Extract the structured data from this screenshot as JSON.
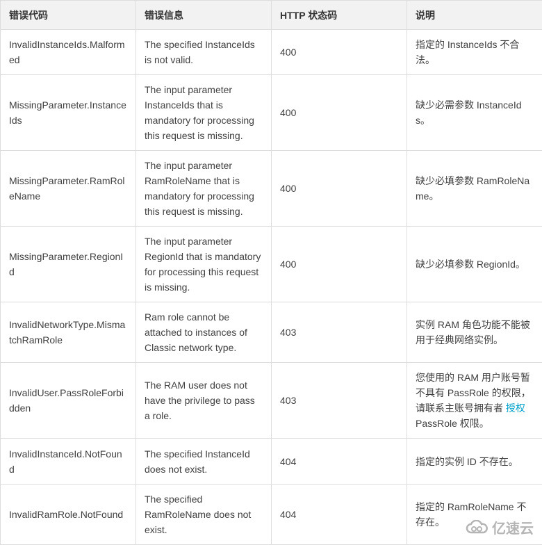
{
  "headers": [
    "错误代码",
    "错误信息",
    "HTTP 状态码",
    "说明"
  ],
  "rows": [
    {
      "code": "InvalidInstanceIds.Malformed",
      "message": "The specified InstanceIds is not valid.",
      "status": "400",
      "desc": "指定的 InstanceIds 不合法。"
    },
    {
      "code": "MissingParameter.InstanceIds",
      "message": "The input parameter InstanceIds that is mandatory for processing this request is missing.",
      "status": "400",
      "desc": "缺少必需参数 InstanceIds。"
    },
    {
      "code": "MissingParameter.RamRoleName",
      "message": "The input parameter RamRoleName that is mandatory for processing this request is missing.",
      "status": "400",
      "desc": "缺少必填参数 RamRoleName。"
    },
    {
      "code": "MissingParameter.RegionId",
      "message": "The input parameter RegionId that is mandatory for processing this request is missing.",
      "status": "400",
      "desc": "缺少必填参数 RegionId。"
    },
    {
      "code": "InvalidNetworkType.MismatchRamRole",
      "message": "Ram role cannot be attached to instances of Classic network type.",
      "status": "403",
      "desc": "实例 RAM 角色功能不能被用于经典网络实例。"
    },
    {
      "code": "InvalidUser.PassRoleForbidden",
      "message": "The RAM user does not have the privilege to pass a role.",
      "status": "403",
      "desc_before": "您使用的 RAM 用户账号暂不具有 PassRole 的权限，请联系主账号拥有者 ",
      "desc_link": "授权",
      "desc_after": " PassRole 权限。"
    },
    {
      "code": "InvalidInstanceId.NotFound",
      "message": "The specified InstanceId does not exist.",
      "status": "404",
      "desc": "指定的实例 ID 不存在。"
    },
    {
      "code": "InvalidRamRole.NotFound",
      "message": "The specified RamRoleName does not exist.",
      "status": "404",
      "desc": "指定的 RamRoleName 不存在。"
    }
  ],
  "watermark": {
    "text": "亿速云",
    "icon": "cloud-logo-icon"
  },
  "colors": {
    "link": "#00a2ca",
    "header_bg": "#f2f2f2",
    "border": "#dddddd"
  }
}
